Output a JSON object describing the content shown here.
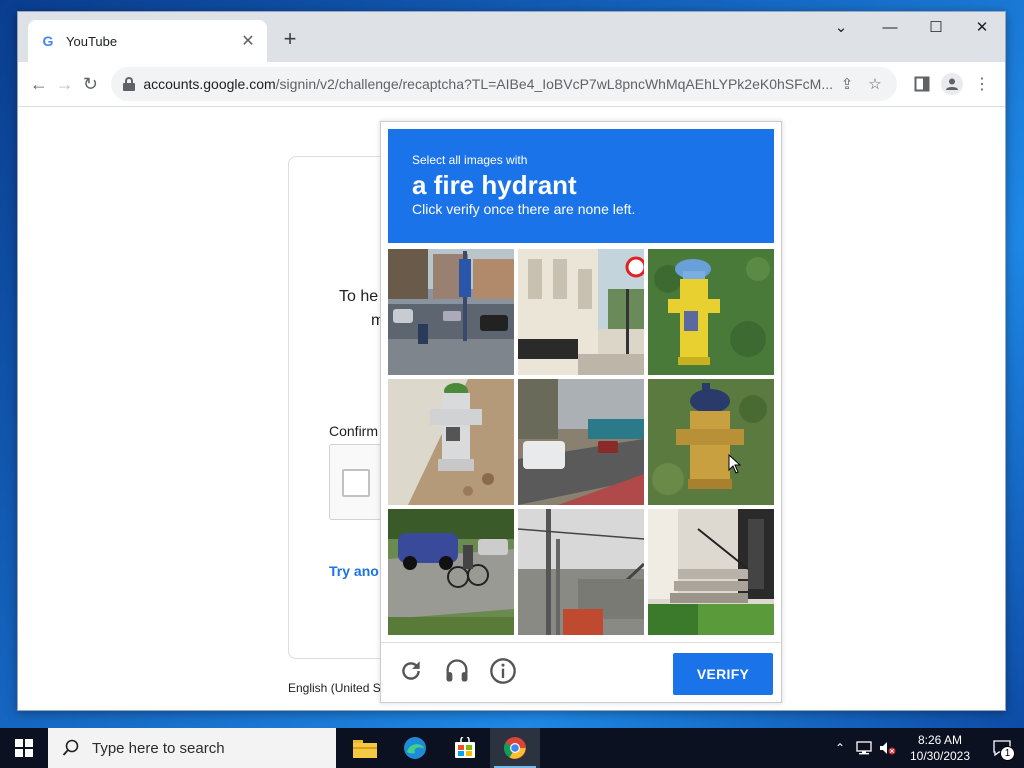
{
  "browser": {
    "tab": {
      "title": "YouTube",
      "favicon": "G"
    },
    "url": {
      "host": "accounts.google.com",
      "path": "/signin/v2/challenge/recaptcha?TL=AIBe4_IoBVcP7wL8pncWhMqAEhLYPk2eK0hSFcM..."
    }
  },
  "signin": {
    "line1": "To he",
    "line2": "m",
    "confirm_label": "Confirm",
    "try_another": "Try ano",
    "language": "English (United S"
  },
  "captcha": {
    "instruction_small": "Select all images with",
    "target": "a fire hydrant",
    "hint": "Click verify once there are none left.",
    "verify_label": "VERIFY",
    "tiles": [
      {
        "label": "street-with-cars-and-sign"
      },
      {
        "label": "white-building-sidewalk"
      },
      {
        "label": "yellow-hydrant-blue-cap"
      },
      {
        "label": "white-hydrant-green-cap"
      },
      {
        "label": "road-with-cars"
      },
      {
        "label": "yellow-hydrant-dark-blue-cap"
      },
      {
        "label": "cyclist-and-blue-car"
      },
      {
        "label": "utility-pole-fire-escape"
      },
      {
        "label": "house-steps-railing"
      }
    ]
  },
  "taskbar": {
    "search_placeholder": "Type here to search",
    "time": "8:26 AM",
    "date": "10/30/2023",
    "notification_count": "1"
  },
  "colors": {
    "accent": "#1a73e8",
    "taskbar": "#0b1120"
  }
}
